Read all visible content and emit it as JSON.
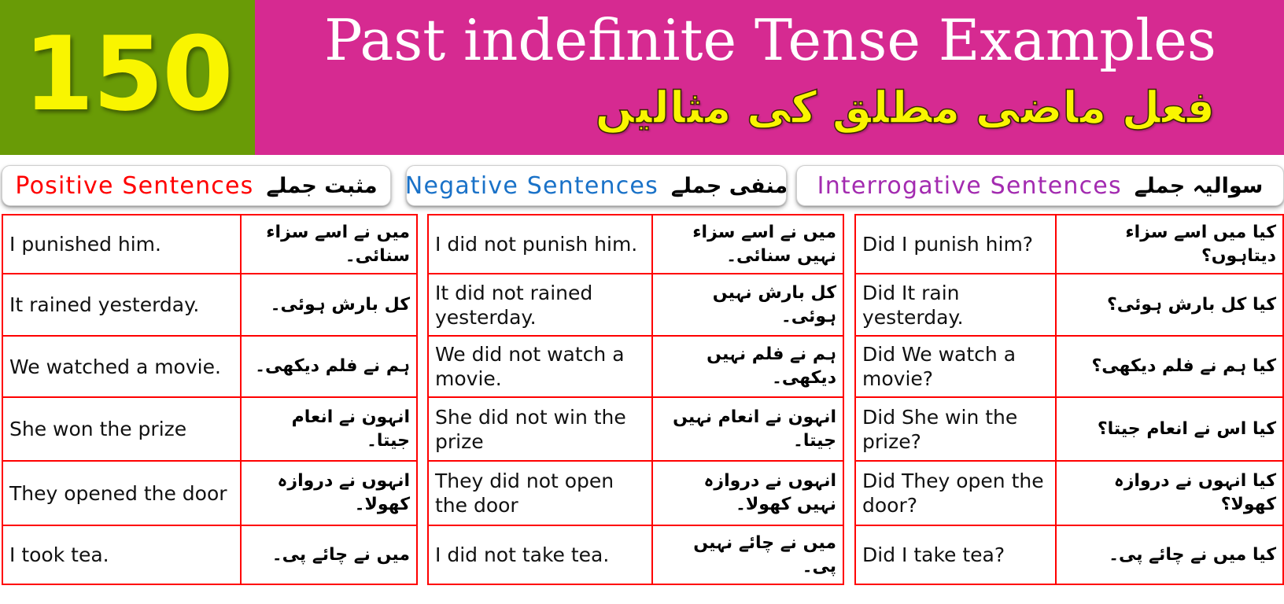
{
  "banner": {
    "count": "150",
    "title": "Past indefinite Tense Examples",
    "subtitle_urdu": "فعل ماضی مطلق کی مثالیں",
    "green_color": "#699b06",
    "pink_color": "#d62a91",
    "count_color": "#f9f500",
    "title_color": "#ffffff"
  },
  "sections": {
    "positive": {
      "label_en": "Positive  Sentences",
      "label_ur": "مثبت جملے",
      "accent": "#ff0000"
    },
    "negative": {
      "label_en": "Negative  Sentences",
      "label_ur": "منفی جملے",
      "accent": "#1a72c8"
    },
    "interrogative": {
      "label_en": "Interrogative  Sentences",
      "label_ur": "سوالیہ جملے",
      "accent": "#a32bb0"
    }
  },
  "tables": {
    "positive": [
      {
        "en": "I punished him.",
        "ur": "میں نے اسے سزاء سنائی۔"
      },
      {
        "en": "It rained yesterday.",
        "ur": "کل بارش ہوئی۔"
      },
      {
        "en": "We watched a movie.",
        "ur": "ہم نے فلم دیکھی۔"
      },
      {
        "en": "She won the prize",
        "ur": "انہون نے انعام جیتا۔"
      },
      {
        "en": "They opened the door",
        "ur": "انہوں نے دروازہ کھولا۔"
      },
      {
        "en": "I took tea.",
        "ur": "میں نے چائے پی۔"
      }
    ],
    "negative": [
      {
        "en": "I did not punish him.",
        "ur": "میں نے اسے سزاء نہیں سنائی۔"
      },
      {
        "en": "It did not rained yesterday.",
        "ur": "کل بارش نہیں ہوئی۔"
      },
      {
        "en": "We did not watch a movie.",
        "ur": "ہم نے فلم نہیں دیکھی۔"
      },
      {
        "en": "She did not win the prize",
        "ur": "انہون نے انعام نہیں جیتا۔"
      },
      {
        "en": "They did not  open the door",
        "ur": "انہوں نے دروازہ نہیں کھولا۔"
      },
      {
        "en": "I did not take tea.",
        "ur": "میں نے چائے نہیں پی۔"
      }
    ],
    "interrogative": [
      {
        "en": "Did I punish him?",
        "ur": "کیا میں اسے سزاء دیتاہوں؟"
      },
      {
        "en": "Did It rain yesterday.",
        "ur": "کیا کل بارش ہوئی؟"
      },
      {
        "en": "Did We watch a movie?",
        "ur": "کیا ہم نے فلم دیکھی؟"
      },
      {
        "en": "Did She win the prize?",
        "ur": "کیا اس نے انعام جیتا؟"
      },
      {
        "en": "Did They open the door?",
        "ur": "کیا انہوں نے دروازہ کھولا؟"
      },
      {
        "en": "Did I take tea?",
        "ur": "کیا میں نے چائے پی۔"
      }
    ]
  }
}
